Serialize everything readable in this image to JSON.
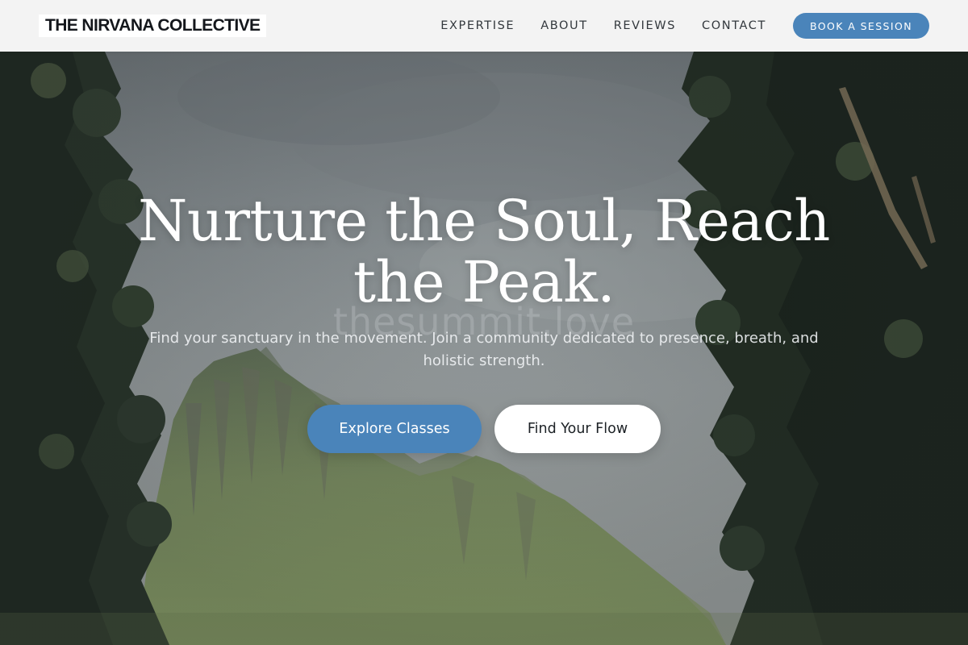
{
  "brand": {
    "name": "THE NIRVANA COLLECTIVE"
  },
  "nav": {
    "links": [
      {
        "label": "EXPERTISE"
      },
      {
        "label": "ABOUT"
      },
      {
        "label": "REVIEWS"
      },
      {
        "label": "CONTACT"
      }
    ],
    "cta_label": "BOOK A SESSION"
  },
  "hero": {
    "headline_line1": "Nurture the Soul, Reach",
    "headline_line2": "the Peak.",
    "watermark": "thesummit.love",
    "subtext": "Find your sanctuary in the movement. Join a community dedicated to presence, breath, and holistic strength.",
    "primary_button": "Explore Classes",
    "secondary_button": "Find Your Flow",
    "background_image": "mountain-landscape-with-trees"
  },
  "colors": {
    "accent": "#4a84ba",
    "nav_background": "#f8f8f8",
    "brand_text": "#14171c",
    "headline_text": "#ffffff"
  }
}
